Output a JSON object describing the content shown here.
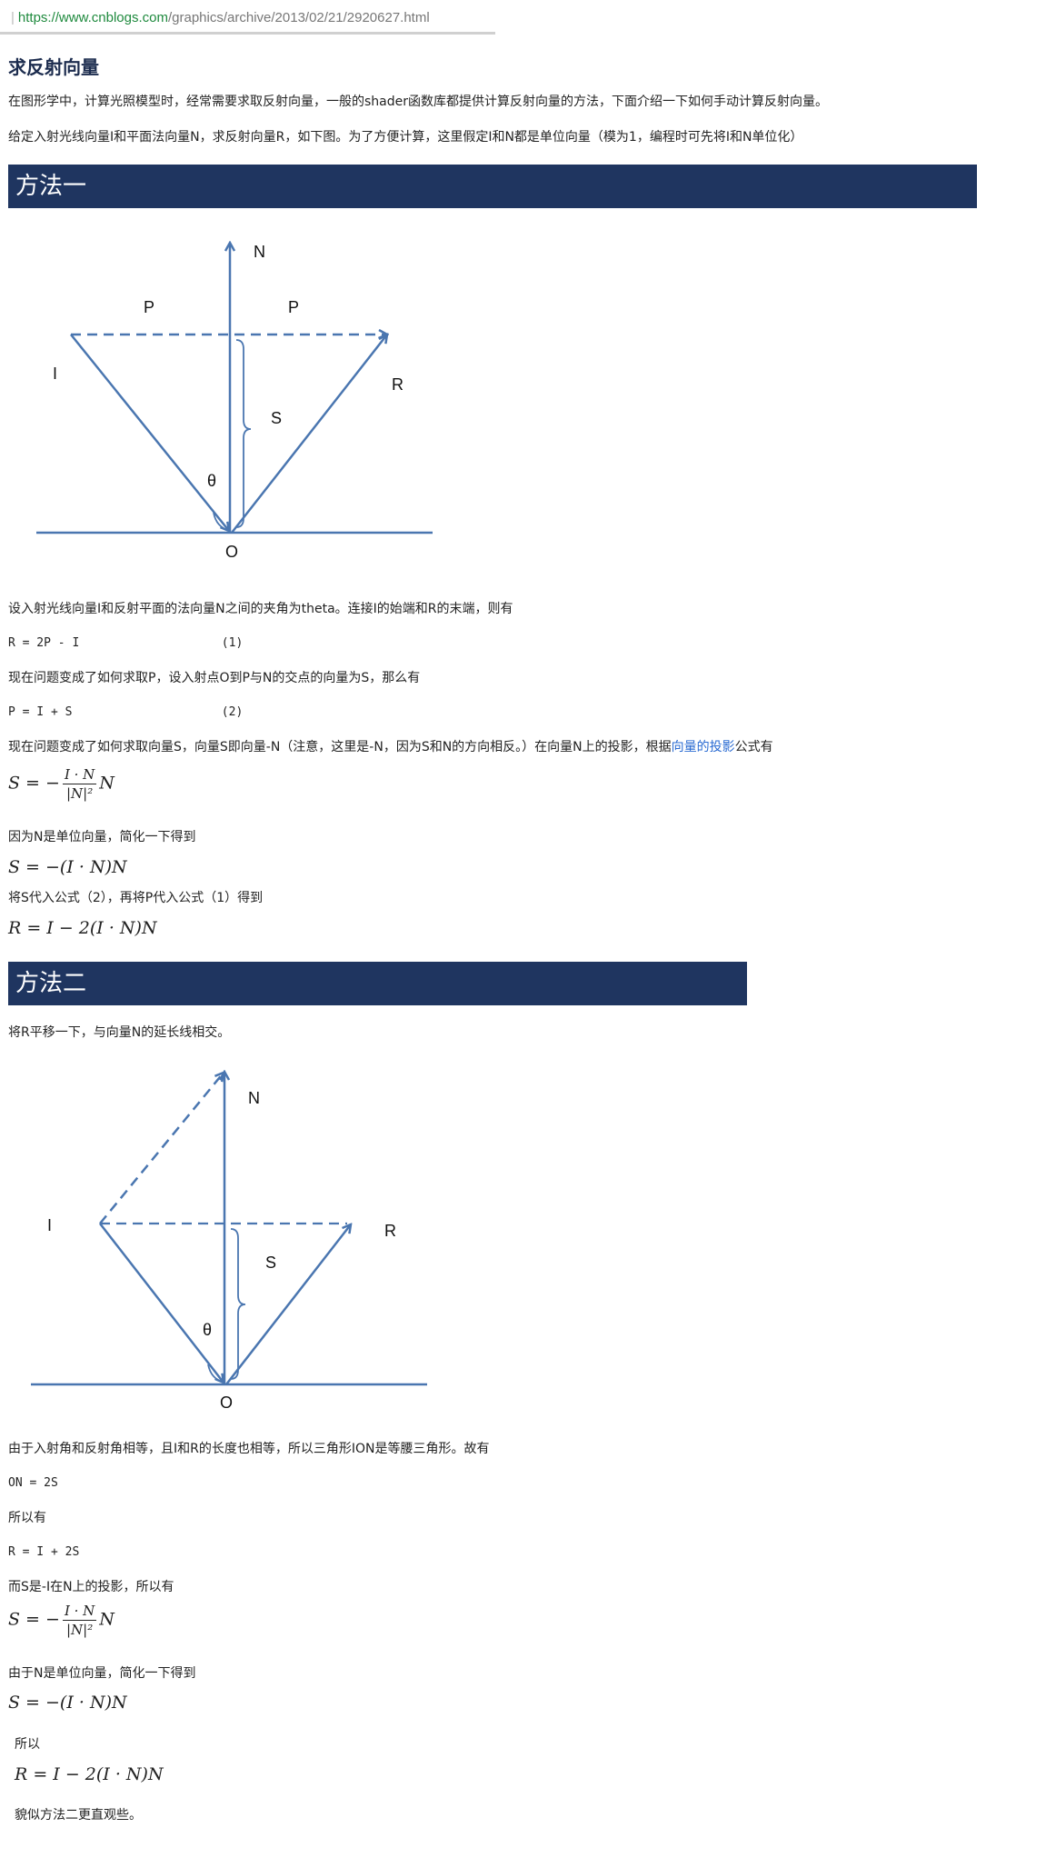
{
  "url": {
    "protocol_host": "https://www.cnblogs.com",
    "path": "/graphics/archive/2013/02/21/2920627.html"
  },
  "title": "求反射向量",
  "intro1": "在图形学中，计算光照模型时，经常需要求取反射向量，一般的shader函数库都提供计算反射向量的方法，下面介绍一下如何手动计算反射向量。",
  "intro2": "给定入射光线向量I和平面法向量N，求反射向量R，如下图。为了方便计算，这里假定I和N都是单位向量（模为1，编程时可先将I和N单位化）",
  "method1": {
    "heading": "方法一",
    "diagram": {
      "N": "N",
      "P1": "P",
      "P2": "P",
      "I": "I",
      "R": "R",
      "S": "S",
      "theta": "θ",
      "O": "O"
    },
    "p1": "设入射光线向量I和反射平面的法向量N之间的夹角为theta。连接I的始端和R的末端，则有",
    "eq1": "R = 2P - I                    (1)",
    "p2": "现在问题变成了如何求取P，设入射点O到P与N的交点的向量为S，那么有",
    "eq2": "P = I + S                     (2)",
    "p3_before": "现在问题变成了如何求取向量S，向量S即向量-N（注意，这里是-N，因为S和N的方向相反。）在向量N上的投影，根据",
    "p3_link": "向量的投影",
    "p3_after": "公式有",
    "formula_S_full": {
      "lhs": "S = −",
      "num": "I · N",
      "den": "|N|²",
      "rhs": "N"
    },
    "p4": "因为N是单位向量，简化一下得到",
    "formula_S_simple": "S = −(I · N)N",
    "p5": "将S代入公式（2），再将P代入公式（1）得到",
    "formula_R": "R = I − 2(I · N)N"
  },
  "method2": {
    "heading": "方法二",
    "p1": "将R平移一下，与向量N的延长线相交。",
    "diagram": {
      "N": "N",
      "I": "I",
      "R": "R",
      "S": "S",
      "theta": "θ",
      "O": "O"
    },
    "p2": "由于入射角和反射角相等，且I和R的长度也相等，所以三角形ION是等腰三角形。故有",
    "eq1": "ON = 2S",
    "p3": "所以有",
    "eq2": "R = I + 2S",
    "p4": "而S是-I在N上的投影，所以有",
    "formula_S_full": {
      "lhs": "S = −",
      "num": "I · N",
      "den": "|N|²",
      "rhs": "N"
    },
    "p5": "由于N是单位向量，简化一下得到",
    "formula_S_simple": "S = −(I · N)N",
    "p6": "所以",
    "formula_R": "R = I − 2(I · N)N",
    "p7": "貌似方法二更直观些。"
  },
  "colors": {
    "banner": "#1f3560",
    "diagram_line": "#4a76b0",
    "link": "#2a6bd2",
    "title": "#1c2c4e"
  }
}
